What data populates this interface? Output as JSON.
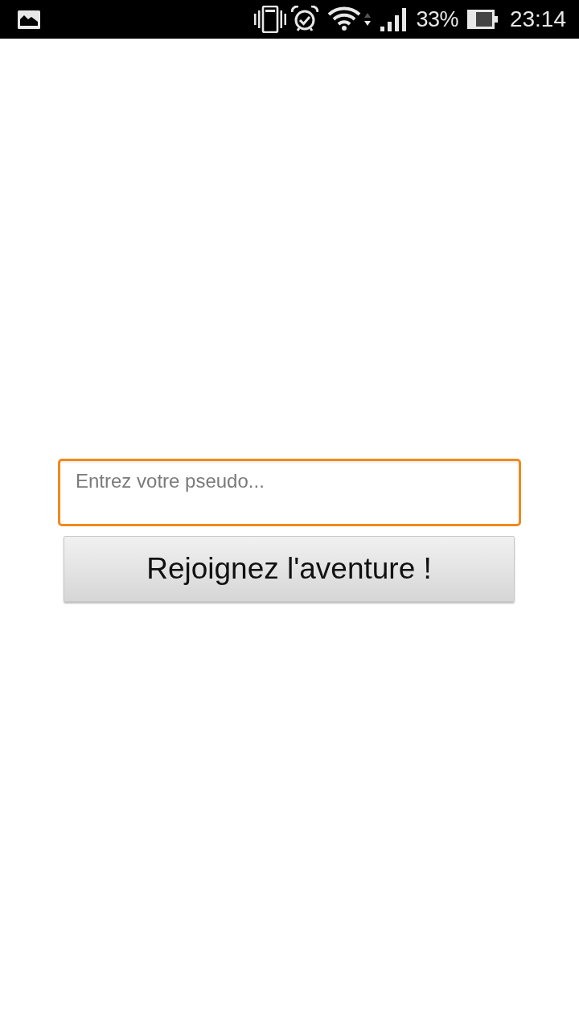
{
  "status_bar": {
    "battery_percent": "33%",
    "time": "23:14"
  },
  "nickname_field": {
    "placeholder": "Entrez votre pseudo...",
    "focused": true
  },
  "join_button": {
    "label": "Rejoignez l'aventure !"
  }
}
